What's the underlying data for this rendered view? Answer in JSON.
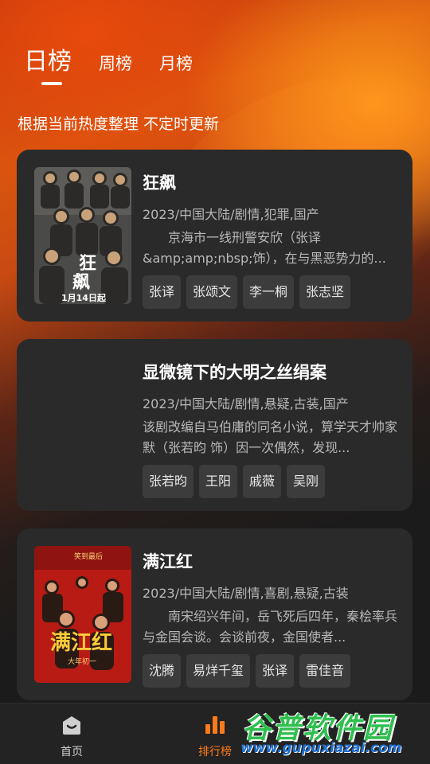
{
  "tabs": [
    "日榜",
    "周榜",
    "月榜"
  ],
  "subtitle": "根据当前热度整理 不定时更新",
  "items": [
    {
      "title": "狂飙",
      "meta": "2023/中国大陆/剧情,犯罪,国产",
      "desc": "　　京海市一线刑警安欣（张译&amp;amp;nbsp;饰），在与黑恶势力的...",
      "cast": [
        "张译",
        "张颂文",
        "李一桐",
        "张志坚"
      ],
      "poster_text": [
        "狂",
        "飙",
        "1月14日起"
      ]
    },
    {
      "title": "显微镜下的大明之丝绢案",
      "meta": "2023/中国大陆/剧情,悬疑,古装,国产",
      "desc": "该剧改编自马伯庸的同名小说，算学天才帅家默（张若昀 饰）因一次偶然，发现...",
      "cast": [
        "张若昀",
        "王阳",
        "戚薇",
        "吴刚"
      ],
      "poster_text": []
    },
    {
      "title": "满江红",
      "meta": "2023/中国大陆/剧情,喜剧,悬疑,古装",
      "desc": "　　南宋绍兴年间，岳飞死后四年，秦桧率兵与金国会谈。会谈前夜，金国使者...",
      "cast": [
        "沈腾",
        "易烊千玺",
        "张译",
        "雷佳音"
      ],
      "poster_text": [
        "满江红",
        "笑到最后",
        "大年初一"
      ]
    }
  ],
  "tabbar": {
    "home": "首页",
    "rank": "排行榜",
    "home_icon": "home-icon",
    "rank_icon": "bar-chart-icon"
  },
  "watermark": {
    "name": "谷普软件园",
    "url": "www.gupuxiazai.com"
  },
  "colors": {
    "accent": "#ff7a1a",
    "card": "#2a2a2a",
    "chip": "#3c3c3c"
  }
}
